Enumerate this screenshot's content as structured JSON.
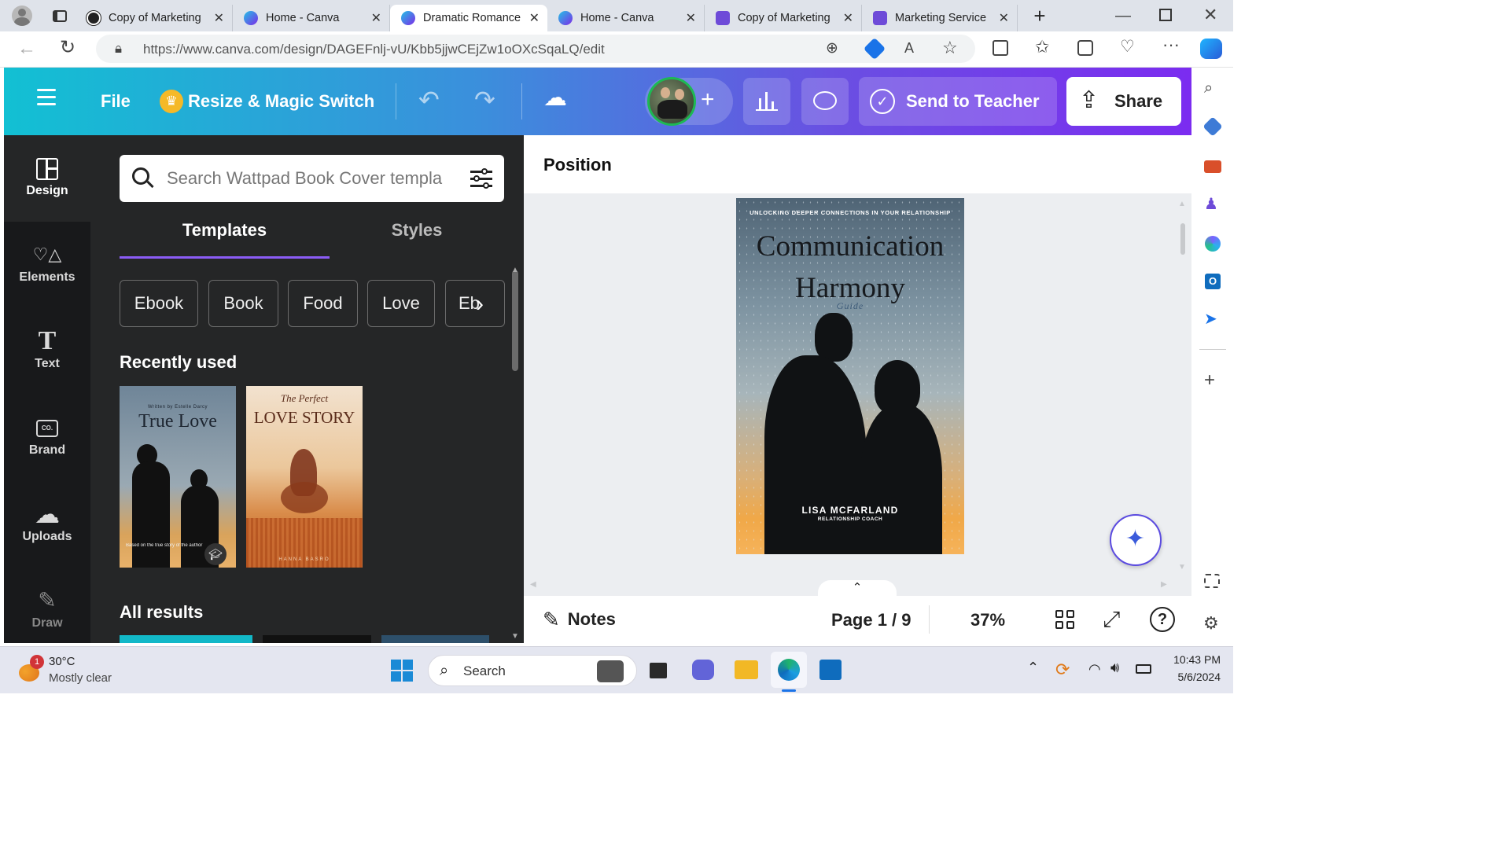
{
  "browser": {
    "tabs": [
      {
        "label": "Copy of Marketing",
        "icon": "dark-circle-icon"
      },
      {
        "label": "Home - Canva",
        "icon": "canva-icon"
      },
      {
        "label": "Dramatic Romance",
        "icon": "canva-icon",
        "active": true
      },
      {
        "label": "Home - Canva",
        "icon": "canva-icon"
      },
      {
        "label": "Copy of Marketing",
        "icon": "calendar-icon"
      },
      {
        "label": "Marketing Service",
        "icon": "calendar-icon"
      }
    ],
    "url": "https://www.canva.com/design/DAGEFnlj-vU/Kbb5jjwCEjZw1oOXcSqaLQ/edit"
  },
  "header": {
    "file_label": "File",
    "resize_label": "Resize & Magic Switch",
    "send_label": "Send to Teacher",
    "share_label": "Share"
  },
  "rail": [
    {
      "label": "Design",
      "icon": "layout-icon"
    },
    {
      "label": "Elements",
      "icon": "shapes-icon"
    },
    {
      "label": "Text",
      "icon": "text-icon"
    },
    {
      "label": "Brand",
      "icon": "brand-icon"
    },
    {
      "label": "Uploads",
      "icon": "cloud-upload-icon"
    },
    {
      "label": "Draw",
      "icon": "draw-icon"
    }
  ],
  "panel": {
    "search_placeholder": "Search Wattpad Book Cover templa",
    "tabs": [
      "Templates",
      "Styles"
    ],
    "chips": [
      "Ebook",
      "Book",
      "Food",
      "Love",
      "Eb"
    ],
    "recent_heading": "Recently used",
    "all_heading": "All results",
    "thumb1": {
      "byline": "Written by Estelle Darcy",
      "title": "True Love",
      "caption": "Based on the true story of the author"
    },
    "thumb2": {
      "script": "The Perfect",
      "title": "LOVE STORY",
      "author": "HANNA BASRO"
    }
  },
  "canvas": {
    "position_label": "Position",
    "cover": {
      "tagline": "UNLOCKING DEEPER CONNECTIONS IN YOUR RELATIONSHIP",
      "title1": "Communication",
      "title2": "Harmony",
      "subtitle": "Guide",
      "author": "LISA MCFARLAND",
      "role": "RELATIONSHIP COACH"
    },
    "notes_label": "Notes",
    "page_label": "Page 1 / 9",
    "zoom_label": "37%"
  },
  "taskbar": {
    "temp": "30°C",
    "weather": "Mostly clear",
    "badge": "1",
    "search": "Search",
    "time": "10:43 PM",
    "date": "5/6/2024"
  }
}
